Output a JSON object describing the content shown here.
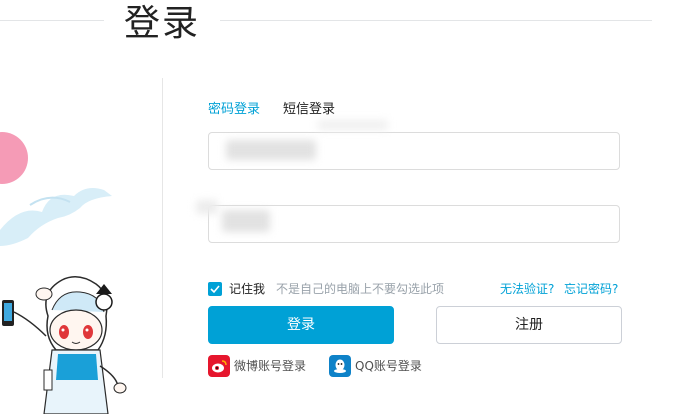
{
  "header": {
    "title": "登录"
  },
  "tabs": [
    {
      "label": "密码登录",
      "active": true
    },
    {
      "label": "短信登录",
      "active": false
    }
  ],
  "form": {
    "username_value": "",
    "password_value": ""
  },
  "remember": {
    "checked": true,
    "label": "记住我",
    "hint": "不是自己的电脑上不要勾选此项"
  },
  "links": {
    "cannot_verify": "无法验证?",
    "forgot_password": "忘记密码?"
  },
  "buttons": {
    "login": "登录",
    "register": "注册"
  },
  "social": {
    "weibo": "微博账号登录",
    "qq": "QQ账号登录"
  },
  "colors": {
    "accent": "#00a1d6",
    "weibo": "#e6162d",
    "qq": "#0e82c8"
  },
  "icons": [
    "check-icon",
    "weibo-icon",
    "qq-icon"
  ]
}
